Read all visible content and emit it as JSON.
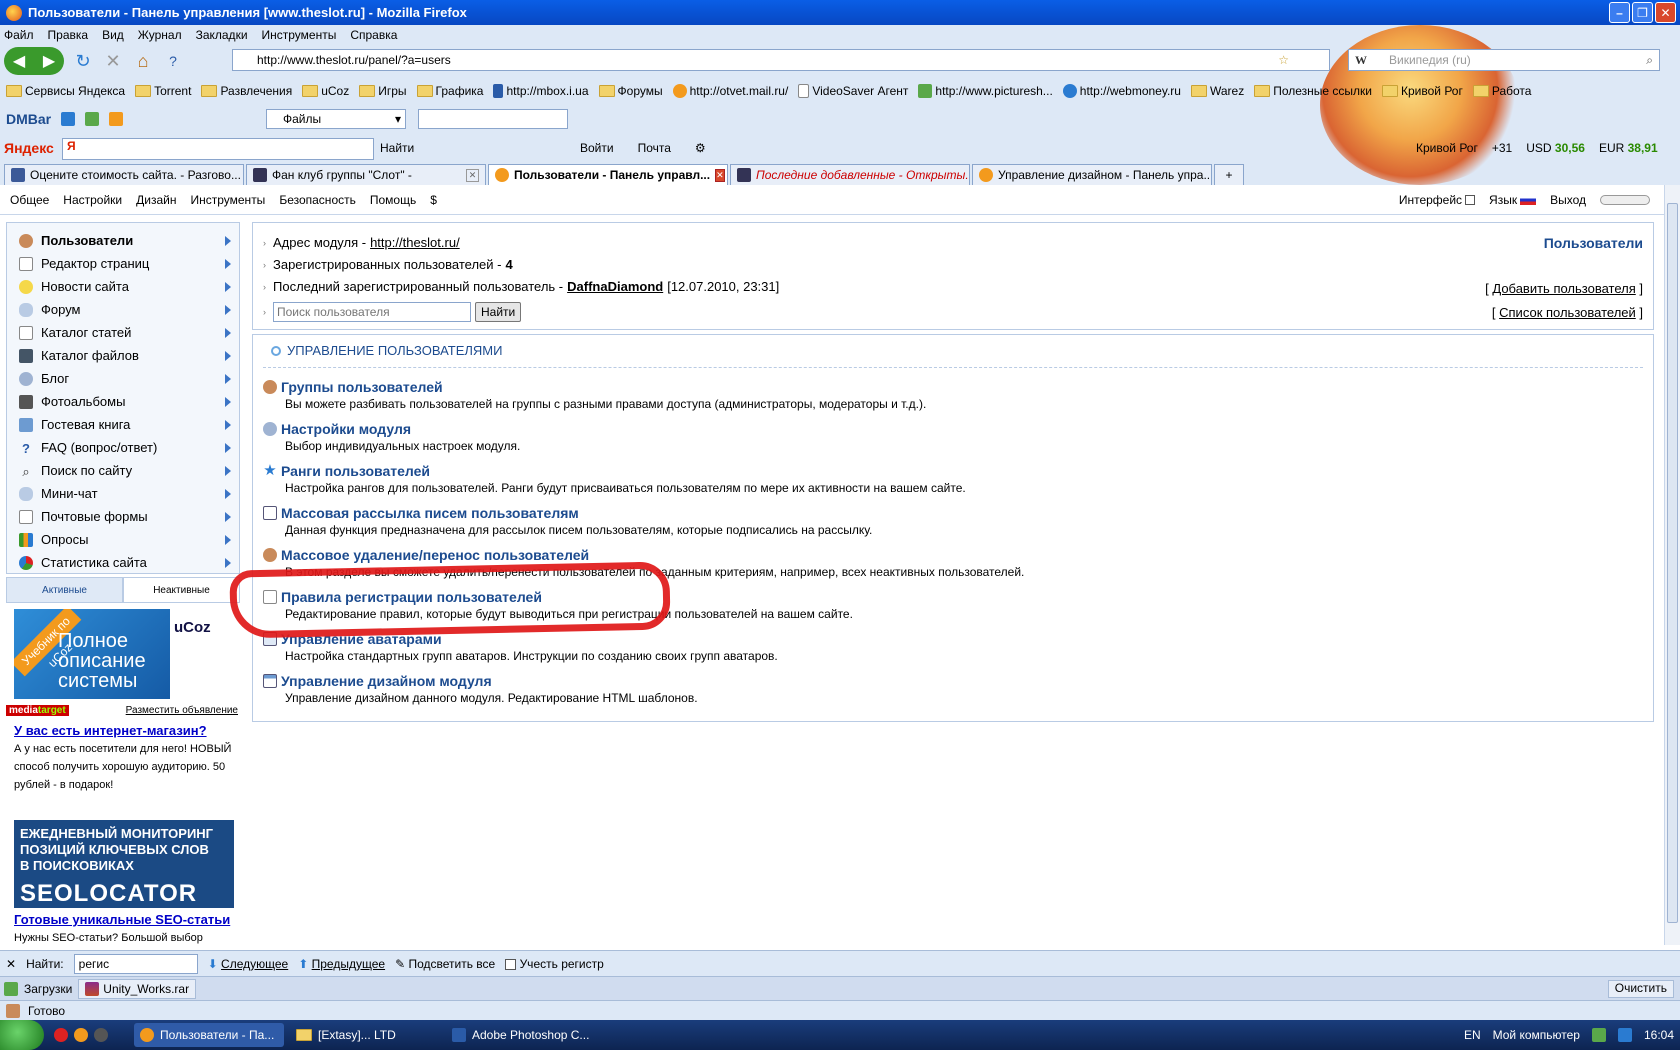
{
  "window": {
    "title": "Пользователи - Панель управления [www.theslot.ru] - Mozilla Firefox"
  },
  "menu": [
    "Файл",
    "Правка",
    "Вид",
    "Журнал",
    "Закладки",
    "Инструменты",
    "Справка"
  ],
  "nav": {
    "url": "http://www.theslot.ru/panel/?a=users",
    "search_placeholder": "Википедия (ru)"
  },
  "bookmarks": [
    "Сервисы Яндекса",
    "Torrent",
    "Развлечения",
    "uCoz",
    "Игры",
    "Графика",
    "http://mbox.i.ua",
    "Форумы",
    "http://otvet.mail.ru/",
    "VideoSaver Агент",
    "http://www.picturesh...",
    "http://webmoney.ru",
    "Warez",
    "Полезные ссылки",
    "Кривой Рог",
    "Работа"
  ],
  "dmbar": {
    "brand": "DMBar",
    "select": "Файлы"
  },
  "yandex": {
    "brand": "Яндекс",
    "logo": "Я",
    "find": "Найти",
    "login": "Войти",
    "mail": "Почта",
    "city": "Кривой Рог",
    "temp": "+31",
    "usd_label": "USD",
    "usd": "30,56",
    "eur_label": "EUR",
    "eur": "38,91"
  },
  "tabs": [
    {
      "label": "Оцените стоимость сайта. - Разгово..."
    },
    {
      "label": "Фан клуб группы \"Слот\" -"
    },
    {
      "label": "Пользователи - Панель управл..."
    },
    {
      "label": "Последние добавленные - Открыты..."
    },
    {
      "label": "Управление дизайном - Панель упра..."
    }
  ],
  "admin": {
    "menu": [
      "Общее",
      "Настройки",
      "Дизайн",
      "Инструменты",
      "Безопасность",
      "Помощь",
      "$"
    ],
    "interface": "Интерфейс",
    "language": "Язык",
    "logout": "Выход"
  },
  "sidebar": {
    "items": [
      "Пользователи",
      "Редактор страниц",
      "Новости сайта",
      "Форум",
      "Каталог статей",
      "Каталог файлов",
      "Блог",
      "Фотоальбомы",
      "Гостевая книга",
      "FAQ (вопрос/ответ)",
      "Поиск по сайту",
      "Мини-чат",
      "Почтовые формы",
      "Опросы",
      "Статистика сайта"
    ],
    "active_tab": "Активные",
    "inactive_tab": "Неактивные"
  },
  "ads": {
    "ucoz_ribbon": "Учебник по uCoz",
    "ucoz_text": "Полное описание системы",
    "ucoz_box": "uCoz",
    "mt_a": "media",
    "mt_b": "target",
    "place_ad": "Разместить объявление",
    "ad1_title": "У вас есть интернет-магазин?",
    "ad1_text": "А у нас есть посетители для него! НОВЫЙ способ получить хорошую аудиторию. 50 рублей - в подарок!",
    "seo_line1": "ЕЖЕДНЕВНЫЙ МОНИТОРИНГ",
    "seo_line2": "ПОЗИЦИЙ КЛЮЧЕВЫХ СЛОВ",
    "seo_line3": "В ПОИСКОВИКАХ",
    "seo_logo": "SEOLOCATOR",
    "ad2_title": "Готовые уникальные SEO-статьи",
    "ad2_text": "Нужны SEO-статьи? Большой выбор"
  },
  "info": {
    "title": "Пользователи",
    "address_label": "Адрес модуля -",
    "address": "http://theslot.ru/",
    "registered": "Зарегистрированных пользователей -",
    "registered_count": "4",
    "last_label": "Последний зарегистрированный пользователь -",
    "last_user": "DaffnaDiamond",
    "last_date": "[12.07.2010, 23:31]",
    "search_placeholder": "Поиск пользователя",
    "find_button": "Найти",
    "add_user": "Добавить пользователя",
    "user_list": "Список пользователей"
  },
  "manage": {
    "heading": "УПРАВЛЕНИЕ ПОЛЬЗОВАТЕЛЯМИ",
    "items": [
      {
        "title": "Группы пользователей",
        "desc": "Вы можете разбивать пользователей на группы с разными правами доступа (администраторы, модераторы и т.д.)."
      },
      {
        "title": "Настройки модуля",
        "desc": "Выбор индивидуальных настроек модуля."
      },
      {
        "title": "Ранги пользователей",
        "desc": "Настройка рангов для пользователей. Ранги будут присваиваться пользователям по мере их активности на вашем сайте."
      },
      {
        "title": "Массовая рассылка писем пользователям",
        "desc": "Данная функция предназначена для рассылок писем пользователям, которые подписались на рассылку."
      },
      {
        "title": "Массовое удаление/перенос пользователей",
        "desc": "В этом разделе вы сможете удалить/перенести пользователей по заданным критериям, например, всех неактивных пользователей."
      },
      {
        "title": "Правила регистрации пользователей",
        "desc": "Редактирование правил, которые будут выводиться при регистрации пользователей на вашем сайте."
      },
      {
        "title": "Управление аватарами",
        "desc": "Настройка стандартных групп аватаров. Инструкции по созданию своих групп аватаров."
      },
      {
        "title": "Управление дизайном модуля",
        "desc": "Управление дизайном данного модуля. Редактирование HTML шаблонов."
      }
    ]
  },
  "findbar": {
    "label": "Найти:",
    "value": "регис",
    "next": "Следующее",
    "prev": "Предыдущее",
    "highlight": "Подсветить все",
    "match_case": "Учесть регистр"
  },
  "downloads": {
    "label": "Загрузки",
    "file": "Unity_Works.rar",
    "clear": "Очистить"
  },
  "status": {
    "text": "Готово"
  },
  "taskbar": {
    "items": [
      "Пользователи - Па...",
      "[Extasy]... LTD",
      "Adobe Photoshop C..."
    ],
    "lang": "EN",
    "computer": "Мой компьютер",
    "time": "16:04"
  },
  "colors": {
    "accent": "#1c4b8f",
    "link": "#0000c8",
    "mark": "#e01818"
  }
}
